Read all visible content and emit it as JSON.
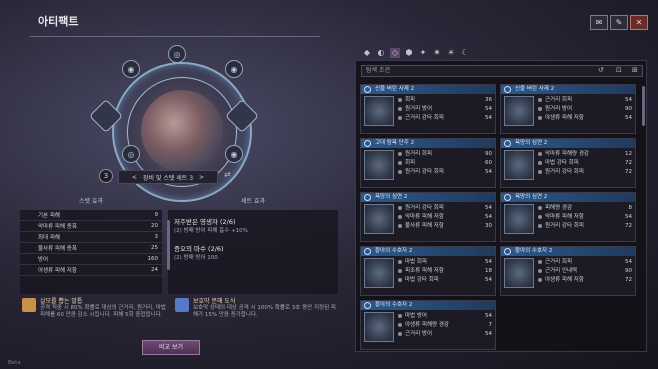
{
  "header": {
    "title": "아티팩트"
  },
  "top_right": {
    "buttons": [
      "✉",
      "✎",
      "✕"
    ]
  },
  "emblem": {
    "set_number": "3",
    "set_label": "장비 및 스텟 세트 3",
    "prev": "<",
    "next": ">"
  },
  "stats": {
    "heading": "스텟 효과",
    "rows": [
      {
        "label": "기본 피해",
        "value": "9"
      },
      {
        "label": "악마류 피해 증폭",
        "value": "20"
      },
      {
        "label": "최대 피해",
        "value": "3"
      },
      {
        "label": "불사류 피해 증폭",
        "value": "25"
      },
      {
        "label": "방어",
        "value": "160"
      },
      {
        "label": "야생류 피해 저항",
        "value": "24"
      }
    ]
  },
  "set_effects": {
    "heading": "세트 효과",
    "groups": [
      {
        "title": "저주받은 영생자 (2/6)",
        "line": "(2) 방패 방어 피해 흡수 +10%"
      },
      {
        "title": "증오의 마수 (2/6)",
        "line": "(2) 방패 방어 100"
      }
    ]
  },
  "skills": [
    {
      "title": "살모를 뽑는 발톱",
      "desc": "공격 적중 시 80% 확률로 대상의 근거리, 원거리, 마법 피해를 60 만큼 감소 시킵니다. 피해 5회 중첩됩니다."
    },
    {
      "title": "보호막 분해 도식",
      "desc": "보호막 상태의 대상 공격 시 100% 확률로 3초 동안 지정된 피해가 15% 만큼 증가합니다."
    }
  ],
  "compare_button": "비교 보기",
  "search": {
    "placeholder": "탐색 조건"
  },
  "cards": [
    {
      "title": "신을 버린 사제 2",
      "lines": [
        {
          "l": "회피",
          "v": "36"
        },
        {
          "l": "원거리 방어",
          "v": "54"
        },
        {
          "l": "근거리 강타 회피",
          "v": "54"
        }
      ]
    },
    {
      "title": "신을 버린 사제 2",
      "lines": [
        {
          "l": "근거리 회피",
          "v": "54"
        },
        {
          "l": "원거리 방어",
          "v": "90"
        },
        {
          "l": "야생류 피해 저항",
          "v": "54"
        }
      ]
    },
    {
      "title": "고대 탐욕 단주 2",
      "lines": [
        {
          "l": "원거리 회피",
          "v": "90"
        },
        {
          "l": "회피",
          "v": "60"
        },
        {
          "l": "원거리 강타 회피",
          "v": "54"
        }
      ]
    },
    {
      "title": "욕망의 심연 2",
      "lines": [
        {
          "l": "악마류 피해량 경감",
          "v": "12"
        },
        {
          "l": "마법 강타 회피",
          "v": "72"
        },
        {
          "l": "원거리 강타 회피",
          "v": "72"
        }
      ]
    },
    {
      "title": "욕망의 심연 2",
      "lines": [
        {
          "l": "원거리 강타 회피",
          "v": "54"
        },
        {
          "l": "악마류 피해 저항",
          "v": "54"
        },
        {
          "l": "불사류 피해 저항",
          "v": "30"
        }
      ]
    },
    {
      "title": "욕망의 심연 2",
      "lines": [
        {
          "l": "피해량 경감",
          "v": "8"
        },
        {
          "l": "악마류 피해 저항",
          "v": "54"
        },
        {
          "l": "원거리 강타 회피",
          "v": "72"
        }
      ]
    },
    {
      "title": "황야의 수호자 2",
      "lines": [
        {
          "l": "마법 회피",
          "v": "54"
        },
        {
          "l": "피조류 피해 저항",
          "v": "18"
        },
        {
          "l": "마법 강타 회피",
          "v": "54"
        }
      ]
    },
    {
      "title": "황야의 수호자 2",
      "lines": [
        {
          "l": "근거리 회피",
          "v": "54"
        },
        {
          "l": "근거리 인내력",
          "v": "90"
        },
        {
          "l": "야생류 피해 저항",
          "v": "72"
        }
      ]
    },
    {
      "title": "황야의 수호자 2",
      "lines": [
        {
          "l": "마법 방어",
          "v": "54"
        },
        {
          "l": "야생류 피해량 경감",
          "v": "7"
        },
        {
          "l": "근거리 방어",
          "v": "54"
        }
      ]
    }
  ],
  "footer": {
    "version": "Beta"
  },
  "tabs": [
    "◆",
    "◐",
    "◇",
    "⬢",
    "✦",
    "✷",
    "☀",
    "☾"
  ]
}
